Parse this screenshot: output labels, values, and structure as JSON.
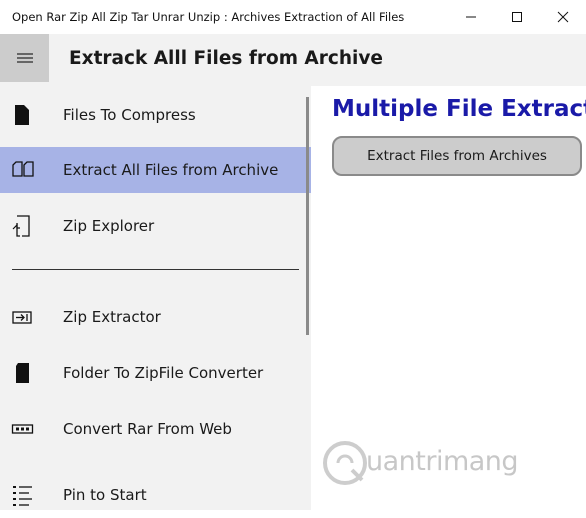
{
  "window": {
    "title": "Open Rar Zip All Zip Tar Unrar Unzip : Archives Extraction of All Files"
  },
  "header": {
    "title": "Extrack Alll Files from  Archive"
  },
  "sidebar": {
    "items": [
      {
        "label": "Files To Compress",
        "icon": "file-icon",
        "selected": false
      },
      {
        "label": "Extract All Files from  Archive",
        "icon": "open-book-icon",
        "selected": true
      },
      {
        "label": "Zip Explorer",
        "icon": "file-export-icon",
        "selected": false
      },
      {
        "label": "Zip Extractor",
        "icon": "extract-arrow-icon",
        "selected": false
      },
      {
        "label": "Folder To ZipFile Converter",
        "icon": "sd-card-icon",
        "selected": false
      },
      {
        "label": "Convert Rar From Web",
        "icon": "dots-box-icon",
        "selected": false
      },
      {
        "label": "Pin to Start",
        "icon": "list-icon",
        "selected": false
      }
    ]
  },
  "main": {
    "title": "Multiple File Extract from Archive",
    "extract_button_label": "Extract Files from Archives"
  },
  "watermark": {
    "text": "uantrimang"
  },
  "colors": {
    "selected_bg": "#a7b3e6",
    "title_blue": "#1a1aa8",
    "sidebar_bg": "#f2f2f2",
    "button_bg": "#cccccc"
  }
}
